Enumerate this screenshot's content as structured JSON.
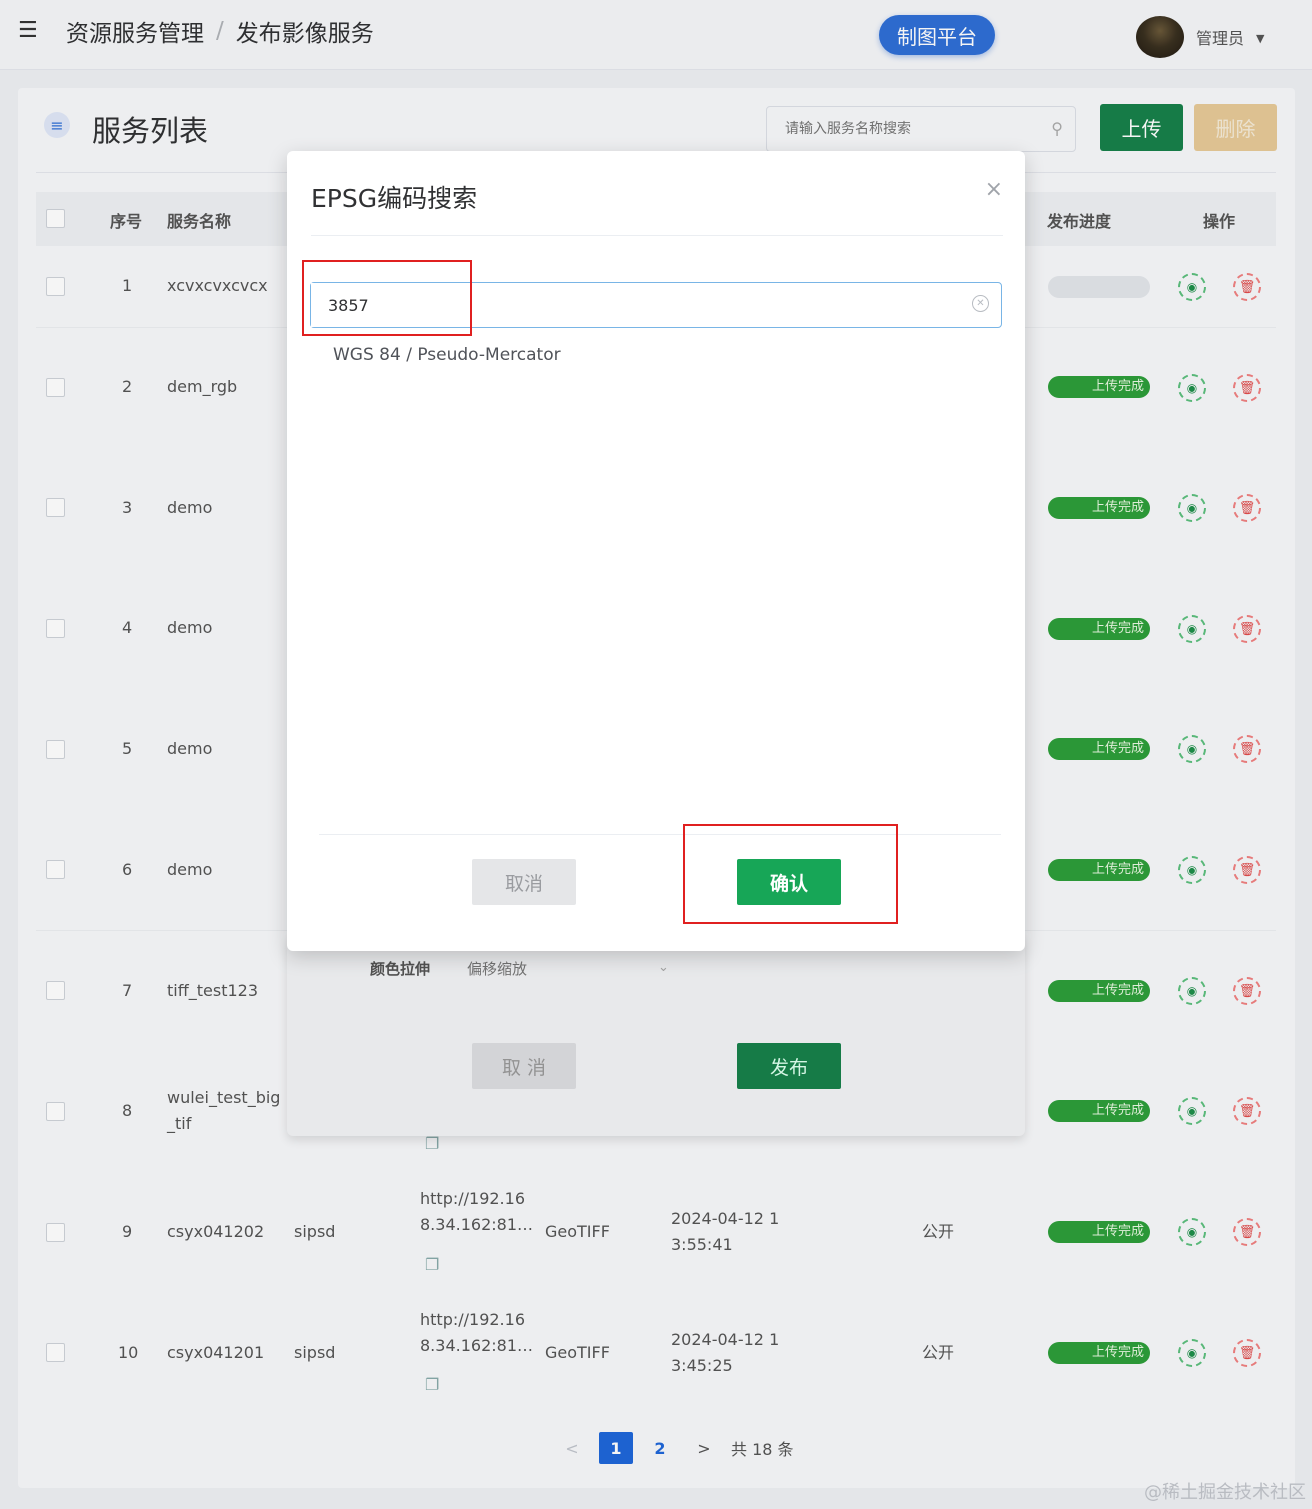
{
  "header": {
    "breadcrumb": [
      "资源服务管理",
      "发布影像服务"
    ],
    "separator": "/",
    "platform_button": "制图平台",
    "user_name": "管理员"
  },
  "card": {
    "title": "服务列表",
    "search_placeholder": "请输入服务名称搜索",
    "upload_label": "上传",
    "delete_label": "删除"
  },
  "table": {
    "headers": {
      "index": "序号",
      "name": "服务名称",
      "progress": "发布进度",
      "actions": "操作"
    },
    "status_done": "上传完成",
    "rows": [
      {
        "index": "1",
        "name": "xcvxcvxcvcx",
        "status": "",
        "group": "",
        "url1": "",
        "url2": "",
        "type": "",
        "time1": "",
        "time2": "",
        "access": ""
      },
      {
        "index": "2",
        "name": "dem_rgb",
        "status": "上传完成"
      },
      {
        "index": "3",
        "name": "demo",
        "status": "上传完成"
      },
      {
        "index": "4",
        "name": "demo",
        "status": "上传完成"
      },
      {
        "index": "5",
        "name": "demo",
        "status": "上传完成"
      },
      {
        "index": "6",
        "name": "demo",
        "status": "上传完成"
      },
      {
        "index": "7",
        "name": "tiff_test123",
        "status": "上传完成"
      },
      {
        "index": "8",
        "name": "wulei_test_big",
        "name2": "_tif",
        "status": "上传完成"
      },
      {
        "index": "9",
        "name": "csyx041202",
        "group": "sipsd",
        "url1": "http://192.16",
        "url2": "8.34.162:81…",
        "type": "GeoTIFF",
        "time1": "2024-04-12 1",
        "time2": "3:55:41",
        "access": "公开",
        "status": "上传完成"
      },
      {
        "index": "10",
        "name": "csyx041201",
        "group": "sipsd",
        "url1": "http://192.16",
        "url2": "8.34.162:81…",
        "type": "GeoTIFF",
        "time1": "2024-04-12 1",
        "time2": "3:45:25",
        "access": "公开",
        "status": "上传完成"
      }
    ]
  },
  "pagination": {
    "prev": "<",
    "pages": [
      "1",
      "2"
    ],
    "next": ">",
    "total": "共 18 条",
    "current": 1
  },
  "publish_dialog": {
    "field_label": "颜色拉伸",
    "field_value": "偏移缩放",
    "cancel_label": "取 消",
    "publish_label": "发布"
  },
  "epsg_modal": {
    "title": "EPSG编码搜索",
    "close": "×",
    "input_value": "3857",
    "suggestion": "WGS 84 / Pseudo-Mercator",
    "cancel_label": "取消",
    "confirm_label": "确认"
  },
  "watermark": "@稀土掘金技术社区",
  "colors": {
    "primary_green": "#17804a",
    "confirm_green": "#17a657",
    "highlight_red": "#e02020",
    "platform_blue": "#2f6fd6"
  },
  "icons": {
    "menu": "menu-fold-icon",
    "db": "database-icon",
    "search": "search-icon",
    "eye": "eye-icon",
    "trash": "trash-icon",
    "copy": "copy-icon",
    "clear": "clear-circle-icon",
    "close": "close-icon"
  }
}
